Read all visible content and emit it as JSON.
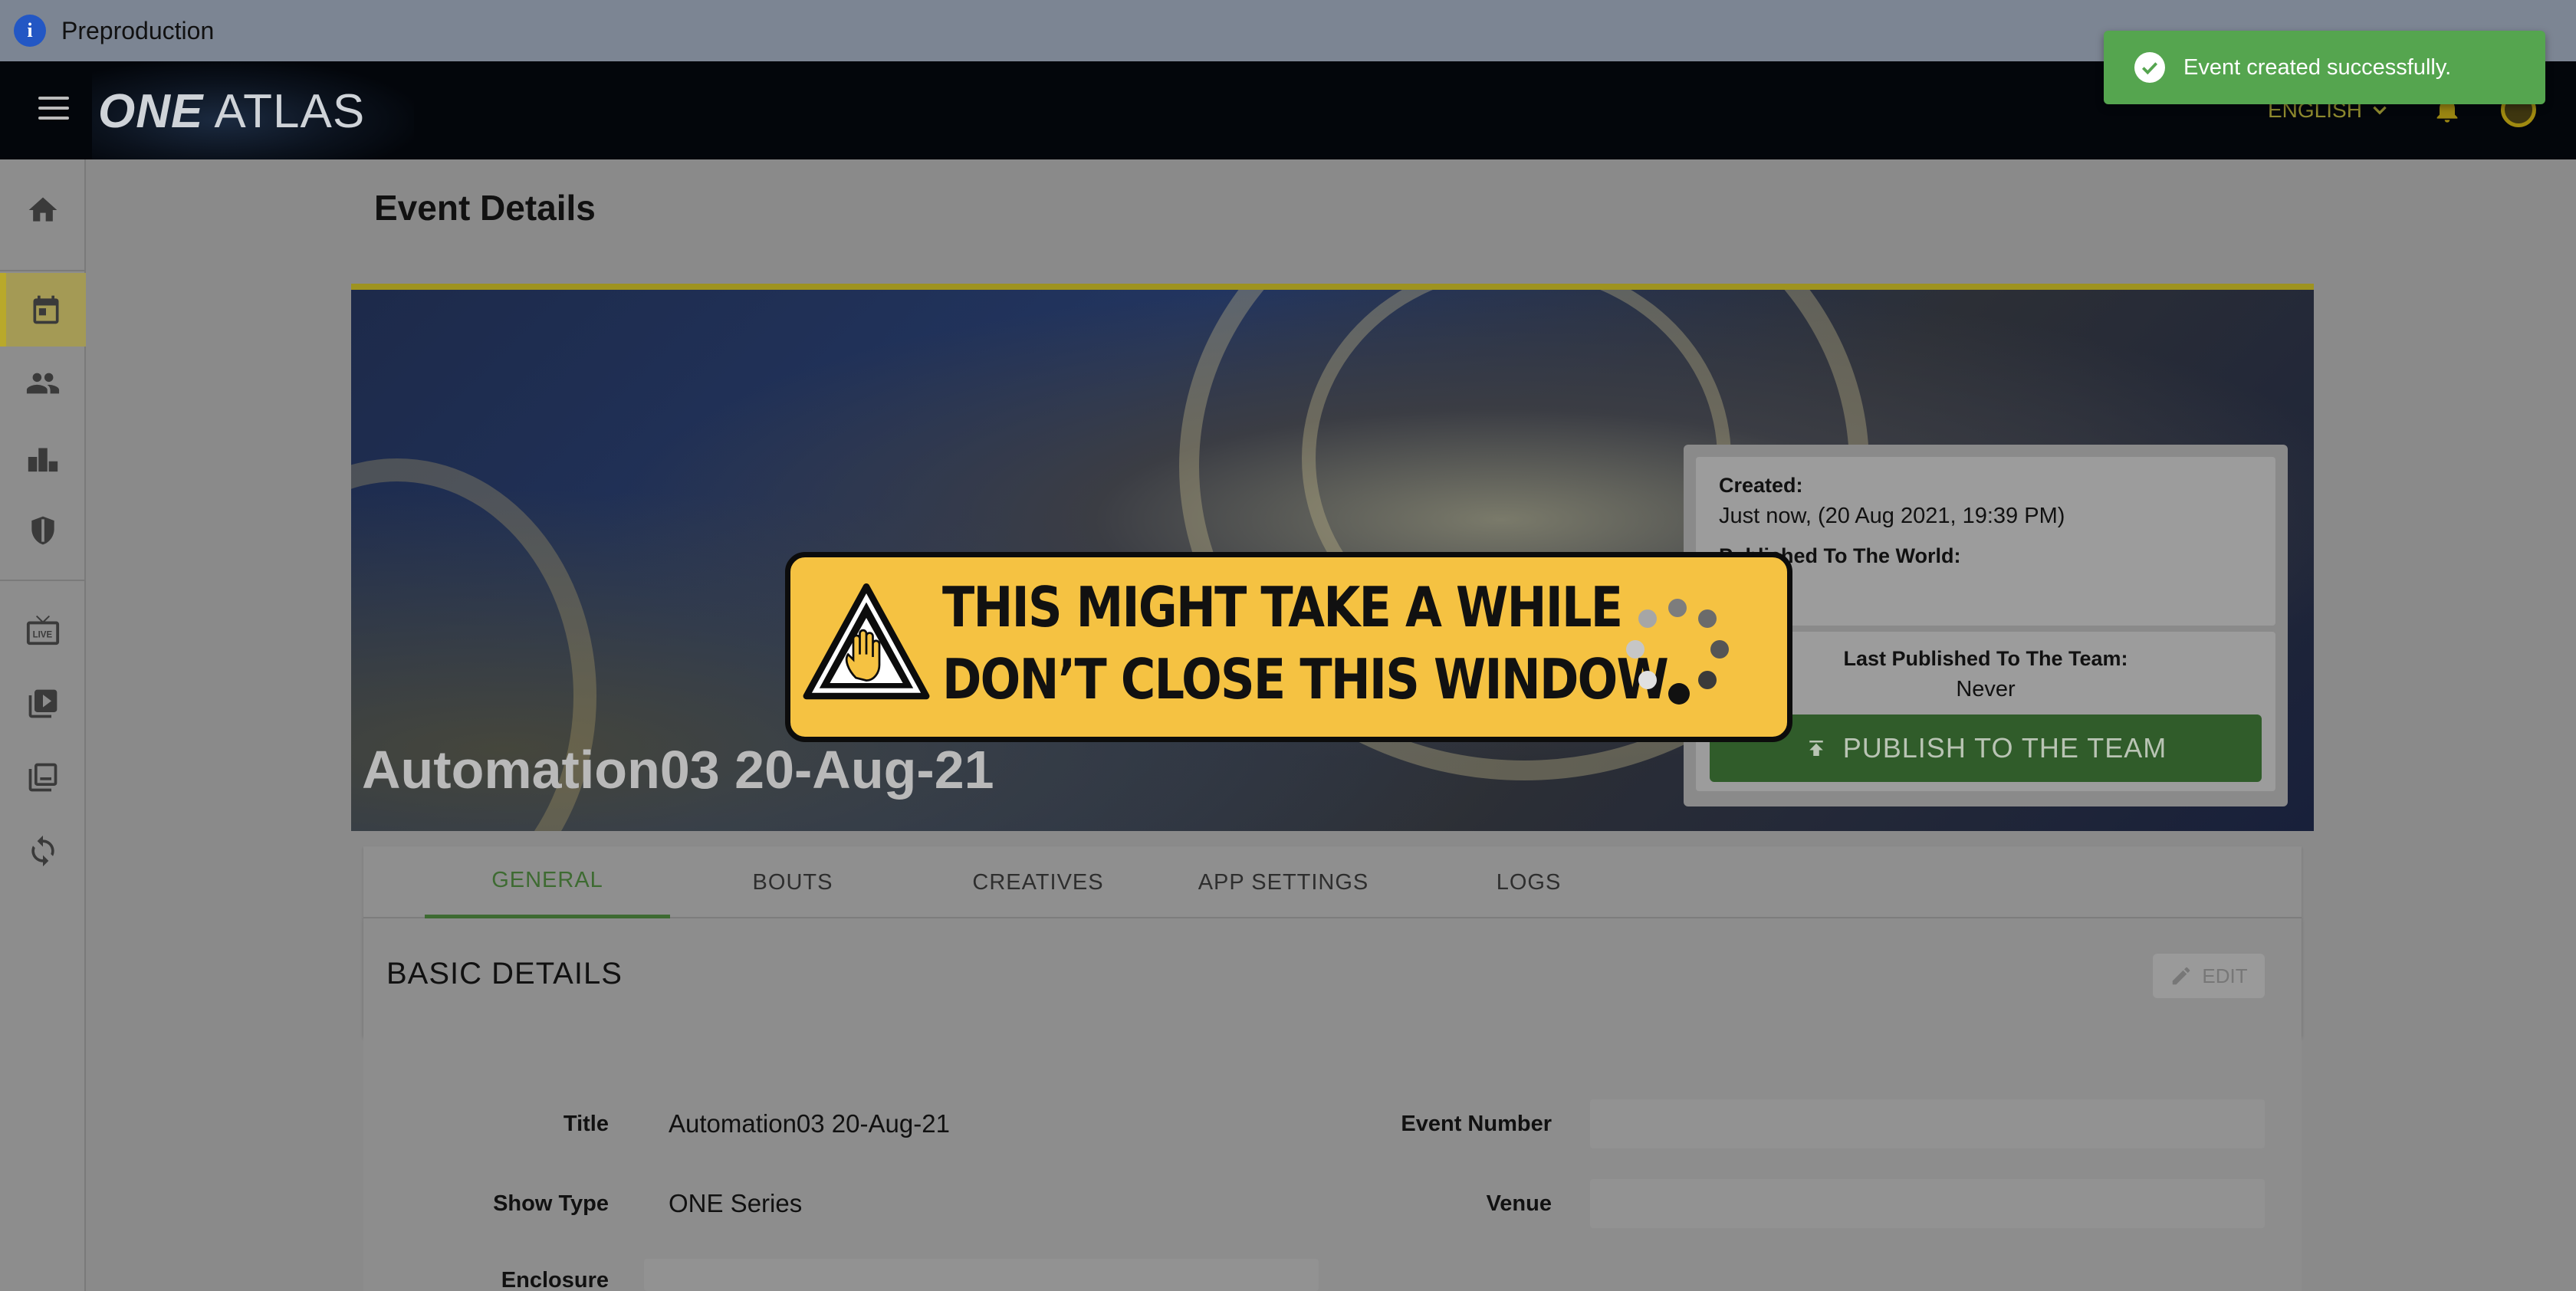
{
  "env": {
    "label": "Preproduction"
  },
  "header": {
    "logo_bold": "ONE",
    "logo_rest": "ATLAS",
    "language": "ENGLISH"
  },
  "page": {
    "title": "Event Details"
  },
  "event": {
    "name": "Automation03 20-Aug-21",
    "created_label": "Created:",
    "created_value": "Just now, (20 Aug 2021, 19:39 PM)",
    "published_world_label": "Published To The World:",
    "last_published_team_label": "Last Published To The Team:",
    "last_published_team_value": "Never",
    "publish_button": "PUBLISH TO THE TEAM"
  },
  "tabs": [
    "GENERAL",
    "BOUTS",
    "CREATIVES",
    "APP SETTINGS",
    "LOGS"
  ],
  "basic_details": {
    "title": "BASIC DETAILS",
    "edit_label": "EDIT",
    "fields": {
      "title_label": "Title",
      "title_value": "Automation03 20-Aug-21",
      "show_type_label": "Show Type",
      "show_type_value": "ONE Series",
      "enclosure_label": "Enclosure",
      "event_number_label": "Event Number",
      "venue_label": "Venue"
    }
  },
  "loader": {
    "line1": "THIS MIGHT TAKE A WHILE",
    "line2": "DON’T CLOSE THIS WINDOW"
  },
  "toast": {
    "message": "Event created successfully."
  },
  "colors": {
    "accent_green": "#3e6b32",
    "toast_green": "#55a54f",
    "loader_yellow": "#f5c242",
    "active_gold": "#b9a92a"
  },
  "icons": [
    "info-icon",
    "menu-icon",
    "chevron-down-icon",
    "bell-icon",
    "account-icon",
    "home-icon",
    "calendar-icon",
    "people-icon",
    "podium-icon",
    "shield-icon",
    "live-tv-icon",
    "video-library-icon",
    "collections-icon",
    "sync-icon",
    "upload-icon",
    "pencil-icon",
    "stop-hand-icon",
    "check-circle-icon"
  ]
}
